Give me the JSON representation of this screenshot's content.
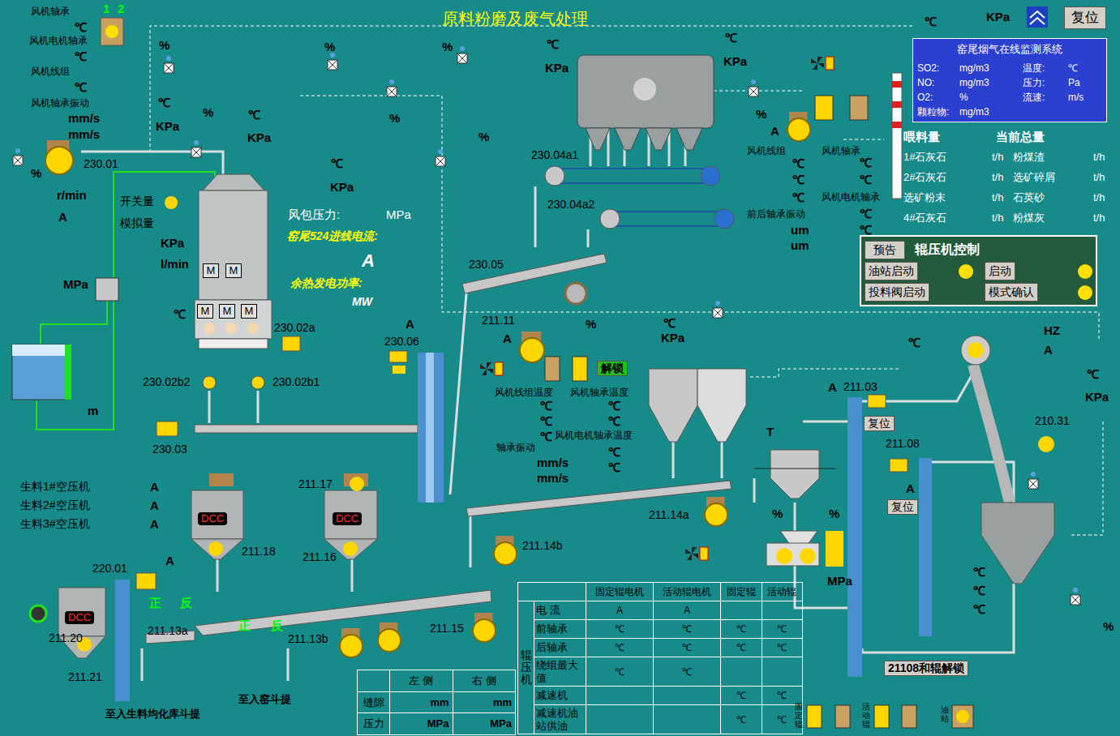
{
  "title": "原料粉磨及废气处理",
  "reset_button": "复位",
  "labels": [
    "风机轴承",
    "1",
    "2",
    "℃",
    "风机电机轴承",
    "℃",
    "风机线组",
    "℃",
    "风机轴承振动",
    "mm/s",
    "mm/s",
    "%",
    "℃",
    "KPa",
    "%",
    "℃",
    "KPa",
    "%",
    "230.01",
    "r/min",
    "A",
    "开关量",
    "模拟量",
    "KPa",
    "l/min",
    "MPa",
    "℃",
    "m",
    "℃",
    "KPa",
    "风包压力:",
    "MPa",
    "窑尾524进线电流:",
    "A",
    "余热发电功率:",
    "MW",
    "%",
    "%",
    "%",
    "%",
    "℃",
    "KPa",
    "℃",
    "KPa",
    "%",
    "A",
    "风机线组",
    "风机轴承",
    "℃",
    "℃",
    "℃",
    "℃",
    "℃",
    "风机电机轴承",
    "前后轴承振动",
    "℃",
    "℃",
    "um",
    "um",
    "230.04a1",
    "230.04a2",
    "230.05",
    "230.02a",
    "230.02b2",
    "230.02b1",
    "230.03",
    "230.06",
    "A",
    "211.11",
    "A",
    "%",
    "℃",
    "KPa",
    "风机线组温度",
    "风机轴承温度",
    "℃",
    "℃",
    "℃",
    "℃",
    "风机电机轴承温度",
    "轴承振动",
    "℃",
    "℃",
    "℃",
    "mm/s",
    "mm/s",
    "211.14a",
    "211.14b",
    "211.15",
    "211.18",
    "211.16",
    "211.17",
    "A",
    "220.01",
    "正",
    "反",
    "211.13a",
    "正",
    "反",
    "211.13b",
    "211.20",
    "211.21",
    "至入生料均化库斗提",
    "至入窑斗提",
    "生料1#空压机",
    "A",
    "生料2#空压机",
    "A",
    "生料3#空压机",
    "A",
    "T",
    "%",
    "%",
    "MPa",
    "A",
    "211.03",
    "211.08",
    "A",
    "HZ",
    "A",
    "℃",
    "℃",
    "KPa",
    "210.31",
    "℃",
    "℃",
    "℃",
    "%",
    "℃",
    "KPa"
  ],
  "mill_motors": [
    "M",
    "M",
    "M",
    "M",
    "M"
  ],
  "dcc_units": [
    "DCC",
    "DCC",
    "DCC"
  ],
  "buttons": {
    "unlock": "解锁",
    "reset_211_03": "复位",
    "reset_211_08": "复位",
    "roller_unlock": "21108和辊解锁"
  },
  "monitor": {
    "title": "窑尾烟气在线监测系统",
    "rows": [
      [
        "SO2:",
        "mg/m3",
        "温度:",
        "℃"
      ],
      [
        "NO:",
        "mg/m3",
        "压力:",
        "Pa"
      ],
      [
        "O2:",
        "%",
        "流速:",
        "m/s"
      ],
      [
        "颗粒物:",
        "mg/m3",
        "",
        ""
      ]
    ]
  },
  "feed": {
    "headers": [
      "喂料量",
      "当前总量"
    ],
    "rows": [
      [
        "1#石灰石",
        "t/h",
        "粉煤渣",
        "t/h"
      ],
      [
        "2#石灰石",
        "t/h",
        "选矿碎屑",
        "t/h"
      ],
      [
        "选矿粉末",
        "t/h",
        "石英砂",
        "t/h"
      ],
      [
        "4#石灰石",
        "t/h",
        "粉煤灰",
        "t/h"
      ]
    ]
  },
  "roller_control": {
    "preview": "预告",
    "title": "辊压机控制",
    "buttons": [
      {
        "label": "油站启动",
        "lamp": true
      },
      {
        "label": "启动",
        "lamp": true
      },
      {
        "label": "投料阀启动",
        "lamp": false
      },
      {
        "label": "模式确认",
        "lamp": true
      }
    ]
  },
  "roller_table": {
    "side": "辊压机",
    "columns": [
      "固定辊电机",
      "活动辊电机",
      "固定辊",
      "活动辊"
    ],
    "rows": [
      {
        "label": "电 流",
        "cells": [
          "A",
          "A",
          "",
          ""
        ]
      },
      {
        "label": "前轴承",
        "cells": [
          "℃",
          "℃",
          "℃",
          "℃"
        ]
      },
      {
        "label": "后轴承",
        "cells": [
          "℃",
          "℃",
          "℃",
          "℃"
        ]
      },
      {
        "label": "绕组最大值",
        "cells": [
          "℃",
          "℃",
          "",
          ""
        ]
      },
      {
        "label": "减速机",
        "cells": [
          "",
          "",
          "℃",
          "℃"
        ]
      },
      {
        "label": "减速机油站供油",
        "cells": [
          "",
          "",
          "℃",
          "℃"
        ]
      }
    ]
  },
  "gap_table": {
    "columns": [
      "左 侧",
      "右 侧"
    ],
    "rows": [
      {
        "label": "缝隙",
        "cells": [
          "mm",
          "mm"
        ]
      },
      {
        "label": "压力",
        "cells": [
          "MPa",
          "MPa"
        ]
      }
    ]
  },
  "bottom_icons": [
    "固定辊",
    "活动辊",
    "油站"
  ]
}
